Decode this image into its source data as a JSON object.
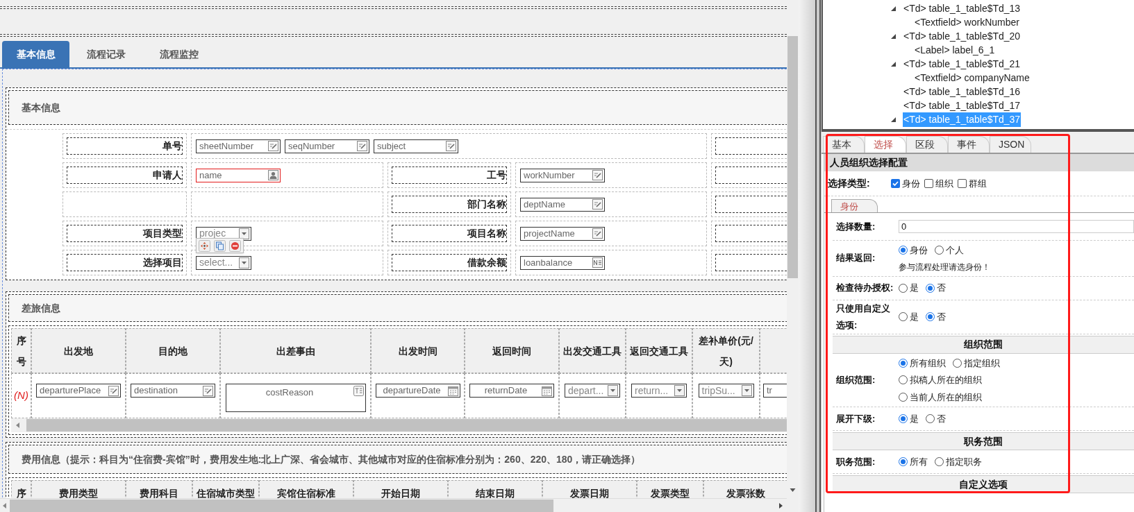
{
  "tabs": [
    {
      "label": "基本信息",
      "selected": true
    },
    {
      "label": "流程记录",
      "selected": false
    },
    {
      "label": "流程监控",
      "selected": false
    }
  ],
  "basic_section": {
    "title": "基本信息",
    "toolbar": true,
    "rows": [
      {
        "label": "单号",
        "fields": [
          {
            "kind": "text",
            "value": "sheetNumber",
            "highlighted": false
          },
          {
            "kind": "text",
            "value": "seqNumber",
            "highlighted": false
          },
          {
            "kind": "text",
            "value": "subject",
            "highlighted": false
          }
        ]
      },
      {
        "label": "申请人",
        "fields": [
          {
            "kind": "person",
            "value": "name",
            "highlighted": true
          }
        ],
        "label_2": "工号",
        "fields_2": [
          {
            "kind": "text",
            "value": "workNumber",
            "highlighted": false
          }
        ]
      },
      {
        "label_2": "部门名称",
        "fields_2": [
          {
            "kind": "text",
            "value": "deptName",
            "highlighted": false
          }
        ]
      },
      {
        "label": "项目类型",
        "fields": [
          {
            "kind": "select",
            "value": "projec",
            "highlighted": false
          }
        ],
        "label_2": "项目名称",
        "fields_2": [
          {
            "kind": "text",
            "value": "projectName",
            "highlighted": false
          }
        ]
      },
      {
        "label": "选择项目",
        "fields": [
          {
            "kind": "select",
            "value": "select...",
            "highlighted": false
          }
        ],
        "label_2": "借款余额",
        "fields_2": [
          {
            "kind": "number",
            "value": "loanbalance",
            "highlighted": false
          }
        ]
      }
    ]
  },
  "travel_section": {
    "title": "差旅信息",
    "columns": [
      "序号",
      "出发地",
      "目的地",
      "出差事由",
      "出发时间",
      "返回时间",
      "出发交通工具",
      "返回交通工具",
      "差补单价(元/天)"
    ],
    "rows": [
      {
        "cells": [
          {
            "kind": "index",
            "value": "(N)"
          },
          {
            "kind": "text",
            "value": "departurePlace"
          },
          {
            "kind": "text",
            "value": "destination"
          },
          {
            "kind": "textarea",
            "value": "costReason"
          },
          {
            "kind": "date",
            "value": "departureDate"
          },
          {
            "kind": "date",
            "value": "returnDate"
          },
          {
            "kind": "select",
            "value": "depart..."
          },
          {
            "kind": "select",
            "value": "return..."
          },
          {
            "kind": "select",
            "value": "tripSu..."
          },
          {
            "kind": "clipped",
            "value": "tr"
          }
        ]
      }
    ]
  },
  "expense_section": {
    "title": "费用信息（提示：科目为“住宿费-宾馆”时，费用发生地:北上广深、省会城市、其他城市对应的住宿标准分别为：260、220、180，请正确选择）",
    "columns": [
      "序",
      "费用类型",
      "费用科目",
      "住宿城市类型",
      "宾馆住宿标准",
      "开始日期",
      "结束日期",
      "发票日期",
      "发票类型",
      "发票张数"
    ]
  },
  "tree": [
    {
      "tag": "<Td>",
      "name": "table_1_table$Td_13",
      "expanded": true,
      "selected": false,
      "children": [
        {
          "tag": "<Textfield>",
          "name": "workNumber",
          "selected": false
        }
      ]
    },
    {
      "tag": "<Td>",
      "name": "table_1_table$Td_20",
      "expanded": true,
      "selected": false,
      "children": [
        {
          "tag": "<Label>",
          "name": "label_6_1",
          "selected": false
        }
      ]
    },
    {
      "tag": "<Td>",
      "name": "table_1_table$Td_21",
      "expanded": true,
      "selected": false,
      "children": [
        {
          "tag": "<Textfield>",
          "name": "companyName",
          "selected": false
        }
      ]
    },
    {
      "tag": "<Td>",
      "name": "table_1_table$Td_16",
      "selected": false
    },
    {
      "tag": "<Td>",
      "name": "table_1_table$Td_17",
      "selected": false
    },
    {
      "tag": "<Td>",
      "name": "table_1_table$Td_37",
      "expanded": true,
      "selected": true
    }
  ],
  "property_tabs": [
    {
      "label": "基本",
      "selected": false
    },
    {
      "label": "选择",
      "selected": true
    },
    {
      "label": "区段",
      "selected": false
    },
    {
      "label": "事件",
      "selected": false
    },
    {
      "label": "JSON",
      "selected": false
    }
  ],
  "panel": {
    "title": "人员组织选择配置",
    "select_type": {
      "label": "选择类型:",
      "options": [
        {
          "label": "身份",
          "checked": true
        },
        {
          "label": "组织",
          "checked": false
        },
        {
          "label": "群组",
          "checked": false
        }
      ]
    },
    "sub_tabs": [
      {
        "label": "身份",
        "selected": true
      }
    ],
    "rows": [
      {
        "kind": "input",
        "label": "选择数量:",
        "value": "0"
      },
      {
        "kind": "radio",
        "label": "结果返回:",
        "lines": [
          [
            {
              "label": "身份",
              "selected": true
            },
            {
              "label": "个人",
              "selected": false
            }
          ]
        ],
        "note": "参与流程处理请选身份！"
      },
      {
        "kind": "radio",
        "label": "检查待办授权:",
        "lines": [
          [
            {
              "label": "是",
              "selected": false
            },
            {
              "label": "否",
              "selected": true
            }
          ]
        ]
      },
      {
        "kind": "radio",
        "label": "只使用自定义选项:",
        "lines": [
          [
            {
              "label": "是",
              "selected": false
            },
            {
              "label": "否",
              "selected": true
            }
          ]
        ]
      },
      {
        "kind": "heading",
        "label": "组织范围"
      },
      {
        "kind": "radio",
        "label": "组织范围:",
        "lines": [
          [
            {
              "label": "所有组织",
              "selected": true
            },
            {
              "label": "指定组织",
              "selected": false
            }
          ],
          [
            {
              "label": "拟稿人所在的组织",
              "selected": false
            }
          ],
          [
            {
              "label": "当前人所在的组织",
              "selected": false
            }
          ]
        ]
      },
      {
        "kind": "radio",
        "label": "展开下级:",
        "lines": [
          [
            {
              "label": "是",
              "selected": true
            },
            {
              "label": "否",
              "selected": false
            }
          ]
        ]
      },
      {
        "kind": "heading",
        "label": "职务范围"
      },
      {
        "kind": "radio",
        "label": "职务范围:",
        "lines": [
          [
            {
              "label": "所有",
              "selected": true
            },
            {
              "label": "指定职务",
              "selected": false
            }
          ]
        ]
      },
      {
        "kind": "heading",
        "label": "自定义选项"
      }
    ]
  }
}
